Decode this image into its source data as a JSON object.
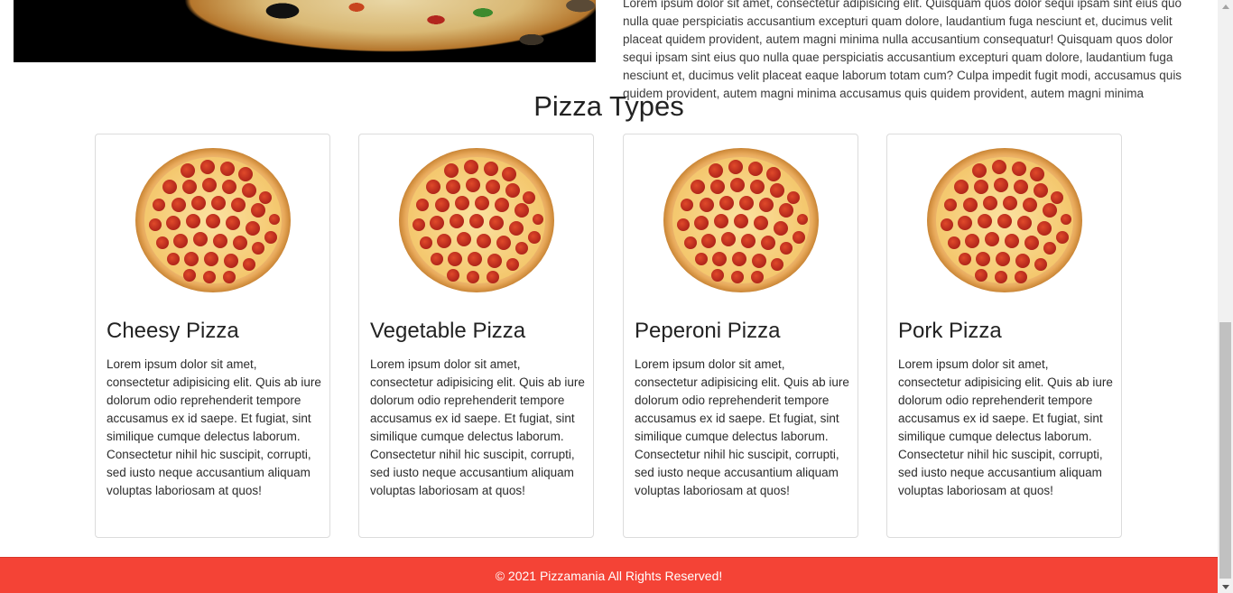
{
  "hero": {
    "text": "Lorem ipsum dolor sit amet, consectetur adipisicing elit. Quisquam quos dolor sequi ipsam sint eius quo nulla quae perspiciatis accusantium excepturi quam dolore, laudantium fuga nesciunt et, ducimus velit placeat quidem provident, autem magni minima nulla accusantium consequatur! Quisquam quos dolor sequi ipsam sint eius quo nulla quae perspiciatis accusantium excepturi quam dolore, laudantium fuga nesciunt et, ducimus velit placeat eaque laborum totam cum? Culpa impedit fugit modi, accusamus quis quidem provident, autem magni minima accusamus quis quidem provident, autem magni minima"
  },
  "section": {
    "title": "Pizza Types"
  },
  "cards": [
    {
      "title": "Cheesy Pizza",
      "text": "Lorem ipsum dolor sit amet, consectetur adipisicing elit. Quis ab iure dolorum odio reprehenderit tempore accusamus ex id saepe. Et fugiat, sint similique cumque delectus laborum. Consectetur nihil hic suscipit, corrupti, sed iusto neque accusantium aliquam voluptas laboriosam at quos!"
    },
    {
      "title": "Vegetable Pizza",
      "text": "Lorem ipsum dolor sit amet, consectetur adipisicing elit. Quis ab iure dolorum odio reprehenderit tempore accusamus ex id saepe. Et fugiat, sint similique cumque delectus laborum. Consectetur nihil hic suscipit, corrupti, sed iusto neque accusantium aliquam voluptas laboriosam at quos!"
    },
    {
      "title": "Peperoni Pizza",
      "text": "Lorem ipsum dolor sit amet, consectetur adipisicing elit. Quis ab iure dolorum odio reprehenderit tempore accusamus ex id saepe. Et fugiat, sint similique cumque delectus laborum. Consectetur nihil hic suscipit, corrupti, sed iusto neque accusantium aliquam voluptas laboriosam at quos!"
    },
    {
      "title": "Pork Pizza",
      "text": "Lorem ipsum dolor sit amet, consectetur adipisicing elit. Quis ab iure dolorum odio reprehenderit tempore accusamus ex id saepe. Et fugiat, sint similique cumque delectus laborum. Consectetur nihil hic suscipit, corrupti, sed iusto neque accusantium aliquam voluptas laboriosam at quos!"
    }
  ],
  "footer": {
    "text": "© 2021 Pizzamania All Rights Reserved!"
  },
  "colors": {
    "footer_bg": "#f44336",
    "card_border": "#dcdcdc"
  },
  "icons": {
    "pizza": "pepperoni-pizza-image"
  }
}
